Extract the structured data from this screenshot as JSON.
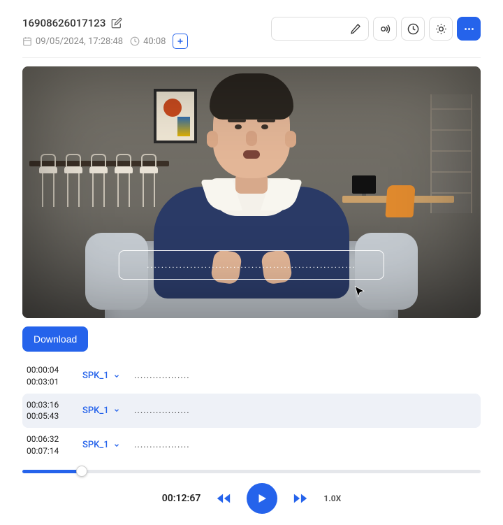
{
  "header": {
    "title": "16908626017123",
    "datetime": "09/05/2024, 17:28:48",
    "duration": "40:08"
  },
  "video": {
    "caption_placeholder": ".........................................................."
  },
  "actions": {
    "download_label": "Download"
  },
  "transcript": {
    "segments": [
      {
        "start": "00:00:04",
        "end": "00:03:01",
        "speaker": "SPK_1",
        "text": "..................",
        "active": false
      },
      {
        "start": "00:03:16",
        "end": "00:05:43",
        "speaker": "SPK_1",
        "text": "..................",
        "active": true
      },
      {
        "start": "00:06:32",
        "end": "00:07:14",
        "speaker": "SPK_1",
        "text": "..................",
        "active": false
      }
    ]
  },
  "player": {
    "current_time": "00:12:67",
    "speed": "1.0X",
    "progress_percent": 13
  }
}
